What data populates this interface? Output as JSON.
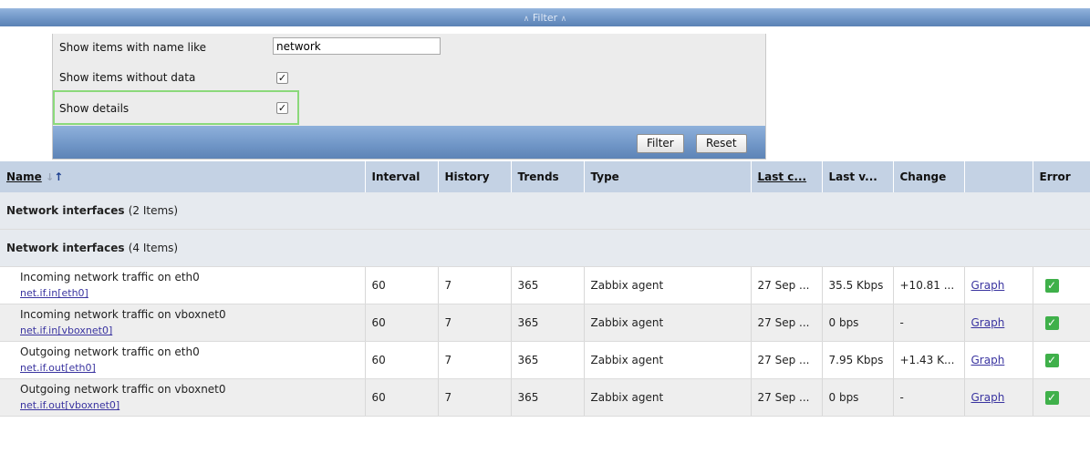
{
  "filter": {
    "title": "Filter",
    "name_like_label": "Show items with name like",
    "name_like_value": "network",
    "without_data_label": "Show items without data",
    "without_data_checked": true,
    "details_label": "Show details",
    "details_checked": true,
    "filter_button": "Filter",
    "reset_button": "Reset"
  },
  "table": {
    "headers": {
      "name": "Name",
      "interval": "Interval",
      "history": "History",
      "trends": "Trends",
      "type": "Type",
      "last_check": "Last c...",
      "last_value": "Last v...",
      "change": "Change",
      "graph": "",
      "error": "Error"
    },
    "groups": [
      {
        "name": "Network interfaces",
        "count": "(2 Items)"
      },
      {
        "name": "Network interfaces",
        "count": "(4 Items)"
      }
    ],
    "rows": [
      {
        "name": "Incoming network traffic on eth0",
        "key": "net.if.in[eth0]",
        "interval": "60",
        "history": "7",
        "trends": "365",
        "type": "Zabbix agent",
        "last_check": "27 Sep ...",
        "last_value": "35.5 Kbps",
        "change": "+10.81 ...",
        "graph": "Graph",
        "error_icon": "check-icon"
      },
      {
        "name": "Incoming network traffic on vboxnet0",
        "key": "net.if.in[vboxnet0]",
        "interval": "60",
        "history": "7",
        "trends": "365",
        "type": "Zabbix agent",
        "last_check": "27 Sep ...",
        "last_value": "0 bps",
        "change": "-",
        "graph": "Graph",
        "error_icon": "check-icon"
      },
      {
        "name": "Outgoing network traffic on eth0",
        "key": "net.if.out[eth0]",
        "interval": "60",
        "history": "7",
        "trends": "365",
        "type": "Zabbix agent",
        "last_check": "27 Sep ...",
        "last_value": "7.95 Kbps",
        "change": "+1.43 K...",
        "graph": "Graph",
        "error_icon": "check-icon"
      },
      {
        "name": "Outgoing network traffic on vboxnet0",
        "key": "net.if.out[vboxnet0]",
        "interval": "60",
        "history": "7",
        "trends": "365",
        "type": "Zabbix agent",
        "last_check": "27 Sep ...",
        "last_value": "0 bps",
        "change": "-",
        "graph": "Graph",
        "error_icon": "check-icon"
      }
    ]
  },
  "colors": {
    "header_blue": "#6f95c6",
    "table_header": "#c4d2e4",
    "highlight_green": "#8bd97b",
    "status_ok": "#3fb04a",
    "link": "#3a34a0"
  }
}
